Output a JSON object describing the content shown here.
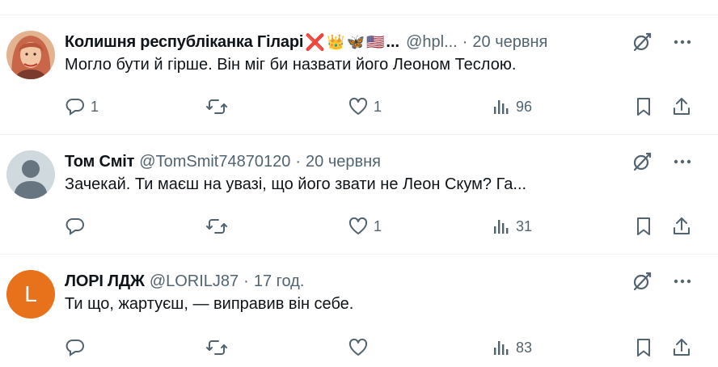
{
  "posts": [
    {
      "name": "Колишня республіканка Гіларі",
      "badges": [
        "❌",
        "👑",
        "🦋",
        "🇺🇸",
        "..."
      ],
      "handle": "@hpl...",
      "dot": "·",
      "time": "20 червня",
      "text": "Могло бути й гірше. Він міг би назвати його Леоном Теслою.",
      "replies": "1",
      "reposts": "",
      "likes": "1",
      "views": "96",
      "avatar": "photo"
    },
    {
      "name": "Том Сміт",
      "badges": [],
      "handle": "@TomSmit74870120",
      "dot": "·",
      "time": "20 червня",
      "text": "Зачекай. Ти маєш на увазі, що його звати не Леон Скум? Га...",
      "replies": "",
      "reposts": "",
      "likes": "1",
      "views": "31",
      "avatar": "default"
    },
    {
      "name": "ЛОРІ ЛДЖ",
      "badges": [],
      "handle": "@LORILJ87",
      "dot": "·",
      "time": "17 год.",
      "text": "Ти що, жартуєш, — виправив він себе.",
      "replies": "",
      "reposts": "",
      "likes": "",
      "views": "83",
      "avatar": "letter",
      "avatar_letter": "L",
      "avatar_color": "#e8711c"
    }
  ],
  "colors": {
    "text": "#0f1419",
    "muted": "#536471",
    "divider": "#eff3f4"
  },
  "icons": [
    "grok-icon",
    "more-icon",
    "reply-icon",
    "repost-icon",
    "like-icon",
    "views-icon",
    "bookmark-icon",
    "share-icon"
  ]
}
